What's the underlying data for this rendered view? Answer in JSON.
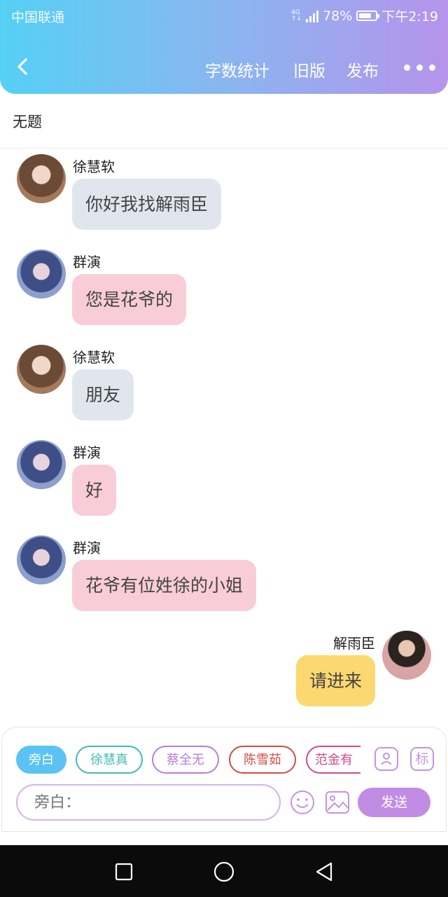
{
  "status_bar": {
    "carrier": "中国联通",
    "network": "4G",
    "battery": "78%",
    "battery_level": 0.78,
    "time": "下午2:19"
  },
  "toolbar": {
    "word_count": "字数统计",
    "old_version": "旧版",
    "publish": "发布"
  },
  "doc_title": "无题",
  "messages": [
    {
      "sender": "徐慧软",
      "text": "你好我找解雨臣",
      "side": "left",
      "bubble_color": "#e1e6ee"
    },
    {
      "sender": "群演",
      "text": "您是花爷的",
      "side": "left",
      "bubble_color": "#f9cdd8"
    },
    {
      "sender": "徐慧软",
      "text": "朋友",
      "side": "left",
      "bubble_color": "#e1e6ee"
    },
    {
      "sender": "群演",
      "text": "好",
      "side": "left",
      "bubble_color": "#f9cdd8"
    },
    {
      "sender": "群演",
      "text": "花爷有位姓徐的小姐",
      "side": "left",
      "bubble_color": "#f9cdd8"
    },
    {
      "sender": "解雨臣",
      "text": "请进来",
      "side": "right",
      "bubble_color": "#fbd970"
    }
  ],
  "characters": [
    {
      "label": "旁白",
      "color": "#5bc3f3",
      "selected": true
    },
    {
      "label": "徐慧真",
      "color": "#3fbcb0"
    },
    {
      "label": "蔡全无",
      "color": "#b77fd6"
    },
    {
      "label": "陈雪茹",
      "color": "#d64b44"
    },
    {
      "label": "范金有",
      "color": "#d44a8a"
    }
  ],
  "tools": {
    "tag_label": "标",
    "contact_icon": "person-card-icon",
    "emoji_icon": "smiley-icon",
    "image_icon": "image-icon"
  },
  "composer": {
    "placeholder": "旁白：",
    "send_label": "发送"
  },
  "colors": {
    "header_start": "#55d0f5",
    "header_end": "#b693ec",
    "accent": "#c08ce4"
  }
}
